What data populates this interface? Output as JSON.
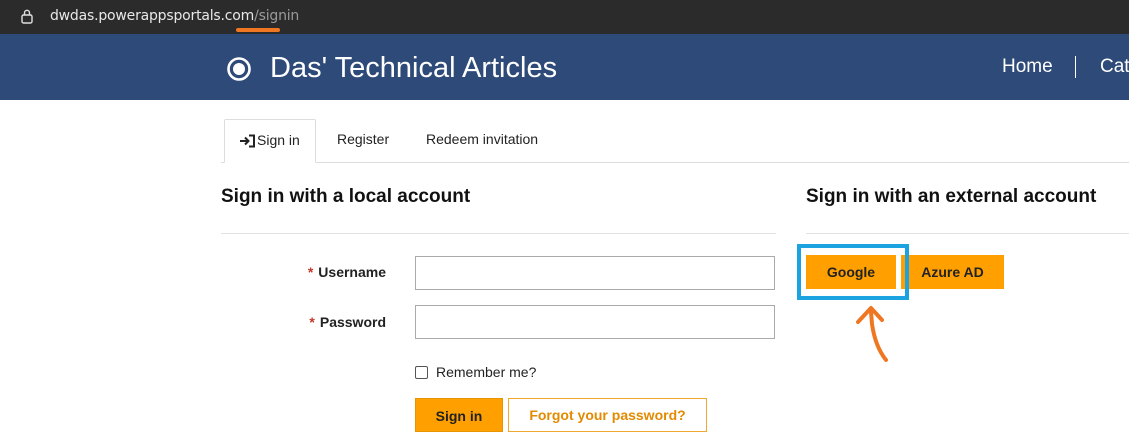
{
  "browser": {
    "url_domain": "dwdas.powerappsportals.com",
    "url_path": "/signin"
  },
  "header": {
    "site_title": "Das' Technical Articles",
    "nav": [
      {
        "label": "Home"
      },
      {
        "label": "Cat"
      }
    ]
  },
  "tabs": [
    {
      "label": "Sign in",
      "active": true
    },
    {
      "label": "Register",
      "active": false
    },
    {
      "label": "Redeem invitation",
      "active": false
    }
  ],
  "local": {
    "heading": "Sign in with a local account",
    "required_mark": "*",
    "username_label": "Username",
    "username_value": "",
    "password_label": "Password",
    "password_value": "",
    "remember_label": "Remember me?",
    "remember_checked": false,
    "signin_button": "Sign in",
    "forgot_button": "Forgot your password?"
  },
  "external": {
    "heading": "Sign in with an external account",
    "providers": [
      {
        "label": "Google",
        "highlighted": true
      },
      {
        "label": "Azure AD",
        "highlighted": false
      }
    ]
  },
  "colors": {
    "header_bg": "#2e4a78",
    "accent_orange": "#ffa000",
    "highlight_blue": "#1aa3e0",
    "annotation_orange": "#f07722"
  }
}
